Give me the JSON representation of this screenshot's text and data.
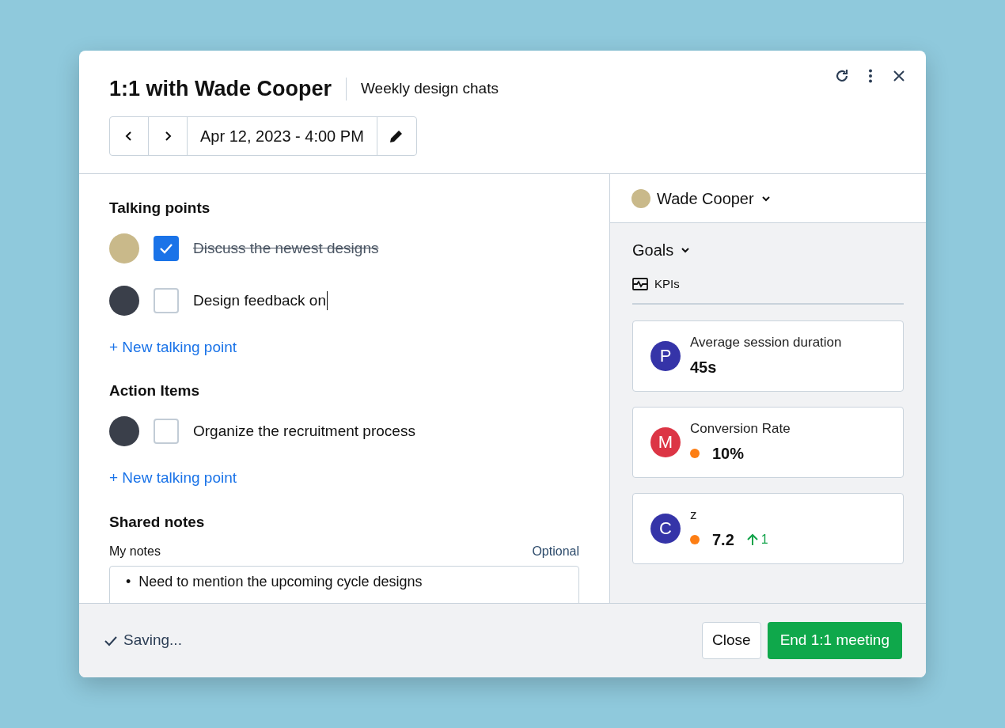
{
  "header": {
    "title": "1:1 with Wade Cooper",
    "subtitle": "Weekly design chats",
    "date": "Apr 12, 2023 - 4:00 PM"
  },
  "talking_points": {
    "heading": "Talking points",
    "items": [
      {
        "text": "Discuss the newest designs",
        "checked": true,
        "editing": false
      },
      {
        "text": "Design feedback on",
        "checked": false,
        "editing": true
      }
    ],
    "add_link": "+ New talking point"
  },
  "action_items": {
    "heading": "Action Items",
    "items": [
      {
        "text": "Organize the recruitment process",
        "checked": false,
        "editing": false
      }
    ],
    "add_link": "+ New talking point"
  },
  "shared_notes": {
    "heading": "Shared notes",
    "label": "My notes",
    "hint": "Optional",
    "bullets": [
      {
        "marker": "•",
        "text": "Need to mention the upcoming cycle designs"
      }
    ]
  },
  "sidebar": {
    "person": "Wade Cooper",
    "section": "Goals",
    "subsection": "KPIs",
    "goals": [
      {
        "initial": "P",
        "color": "#3534a8",
        "name": "Average session duration",
        "value": "45s"
      },
      {
        "initial": "M",
        "color": "#dc3545",
        "name": "Conversion Rate",
        "value": "10%",
        "status": {
          "color": "#fd7e14"
        }
      },
      {
        "initial": "C",
        "color": "#3534a8",
        "name": "z",
        "value": "7.2",
        "status": {
          "color": "#fd7e14"
        },
        "trend": "1"
      }
    ]
  },
  "footer": {
    "status": "Saving...",
    "buttons": [
      "Close",
      "End 1:1 meeting"
    ]
  }
}
